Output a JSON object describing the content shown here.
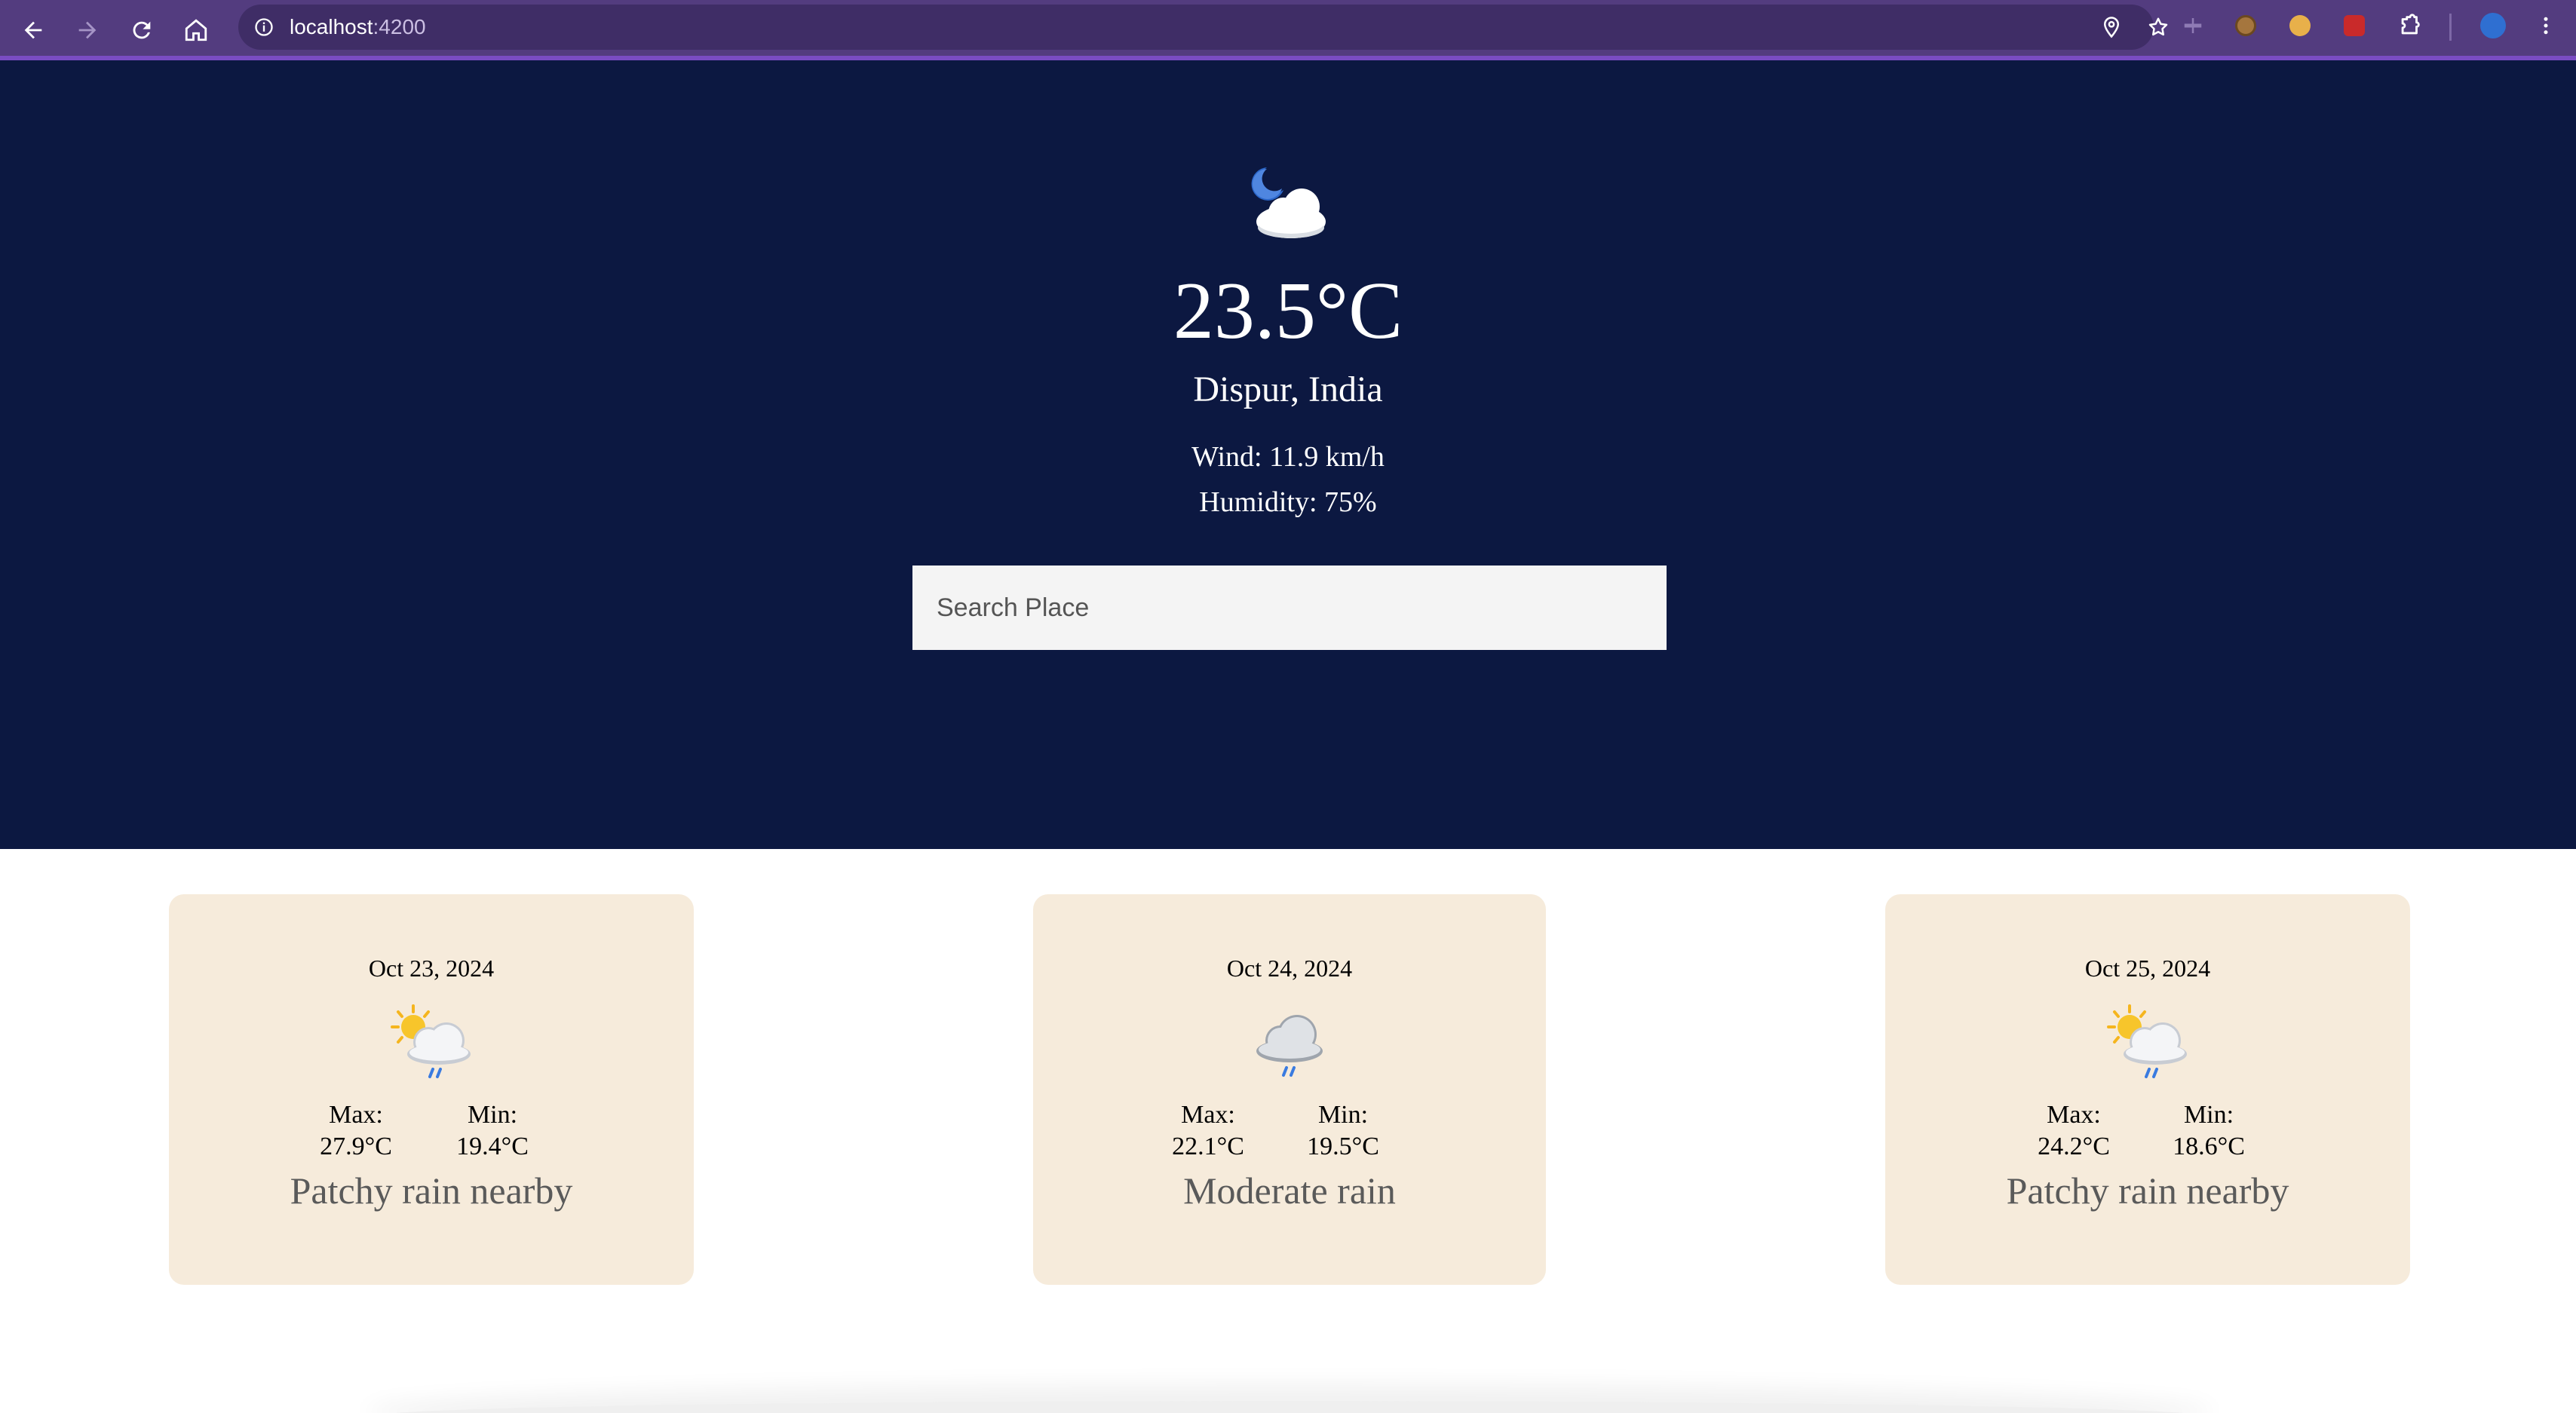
{
  "browser": {
    "url_host": "localhost",
    "url_port": ":4200"
  },
  "current": {
    "temperature": "23.5°C",
    "location": "Dispur, India",
    "wind": "Wind: 11.9 km/h",
    "humidity": "Humidity: 75%",
    "icon": "moon-cloud-icon"
  },
  "search": {
    "placeholder": "Search Place",
    "value": ""
  },
  "forecast": [
    {
      "date": "Oct 23, 2024",
      "max_label": "Max:",
      "max_value": "27.9°C",
      "min_label": "Min:",
      "min_value": "19.4°C",
      "condition": "Patchy rain nearby",
      "icon": "sun-cloud-rain-icon"
    },
    {
      "date": "Oct 24, 2024",
      "max_label": "Max:",
      "max_value": "22.1°C",
      "min_label": "Min:",
      "min_value": "19.5°C",
      "condition": "Moderate rain",
      "icon": "cloud-rain-icon"
    },
    {
      "date": "Oct 25, 2024",
      "max_label": "Max:",
      "max_value": "24.2°C",
      "min_label": "Min:",
      "min_value": "18.6°C",
      "condition": "Patchy rain nearby",
      "icon": "sun-cloud-rain-icon"
    }
  ],
  "colors": {
    "chrome": "#533c7f",
    "hero_bg": "#0c1841",
    "card_bg": "#f6ebdb"
  }
}
